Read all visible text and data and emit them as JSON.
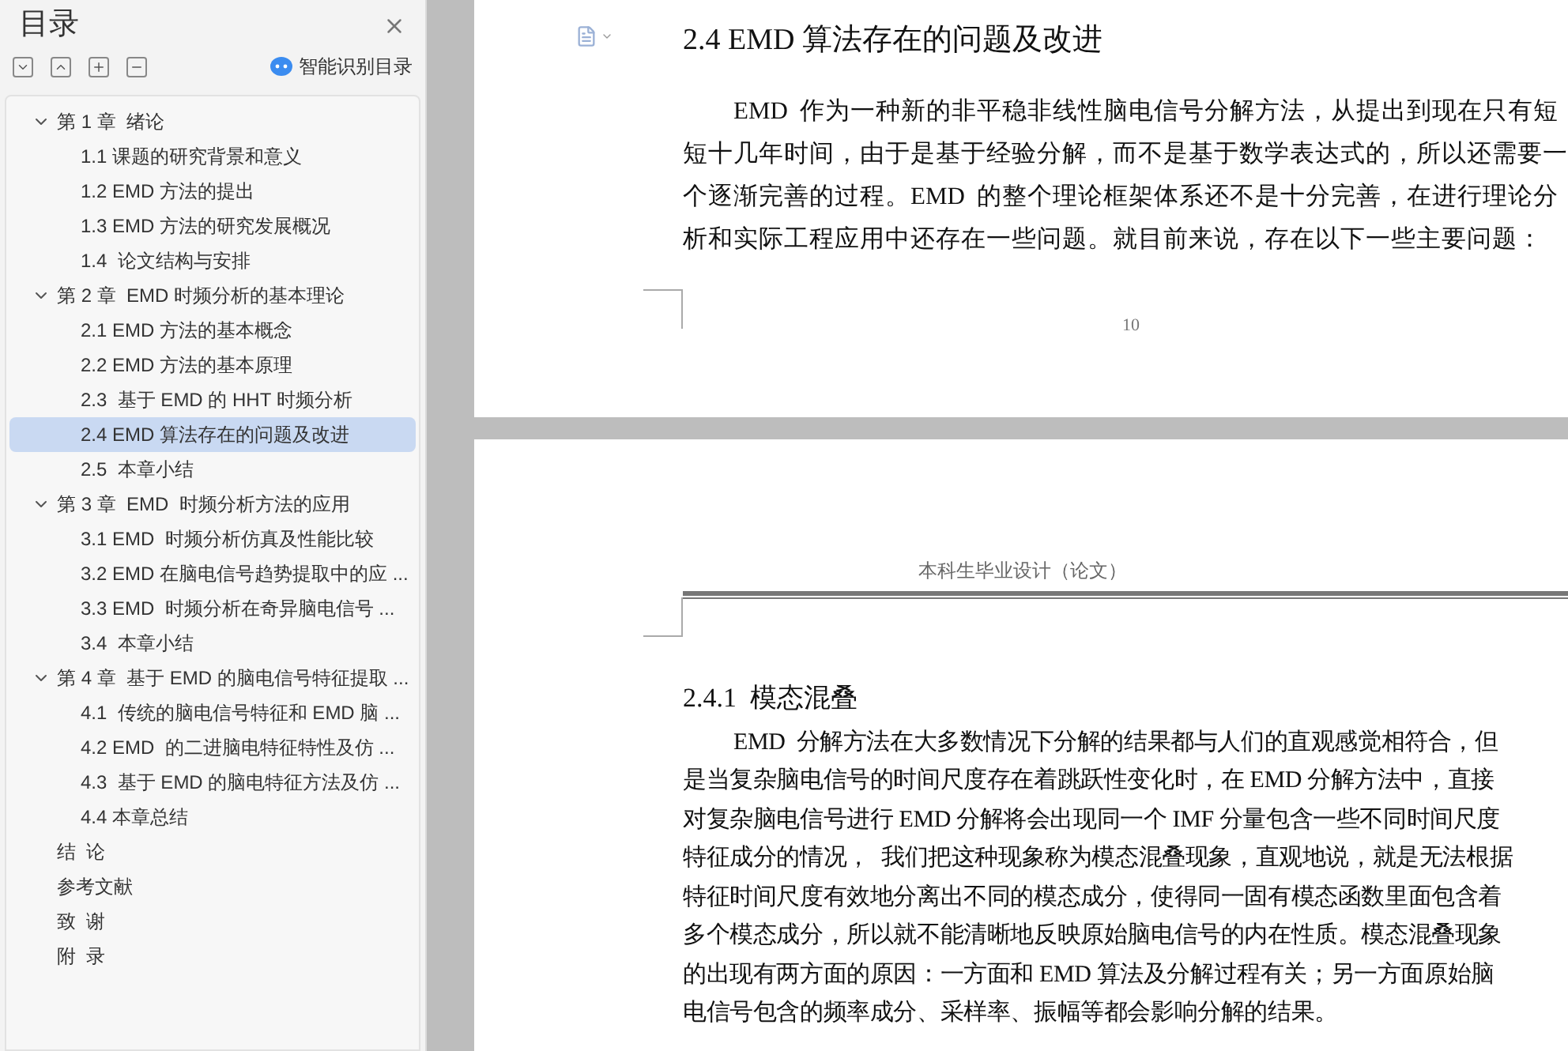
{
  "sidebar": {
    "title": "目录",
    "smart_button": "智能识别目录",
    "toc": [
      {
        "label": "第 1 章  绪论",
        "expanded": true,
        "selected": false,
        "children": [
          {
            "label": "1.1 课题的研究背景和意义",
            "selected": false
          },
          {
            "label": "1.2 EMD 方法的提出",
            "selected": false
          },
          {
            "label": "1.3 EMD 方法的研究发展概况",
            "selected": false
          },
          {
            "label": "1.4  论文结构与安排",
            "selected": false
          }
        ]
      },
      {
        "label": "第 2 章  EMD 时频分析的基本理论",
        "expanded": true,
        "selected": false,
        "children": [
          {
            "label": "2.1 EMD 方法的基本概念",
            "selected": false
          },
          {
            "label": "2.2 EMD 方法的基本原理",
            "selected": false
          },
          {
            "label": "2.3  基于 EMD 的 HHT 时频分析",
            "selected": false
          },
          {
            "label": "2.4 EMD 算法存在的问题及改进",
            "selected": true
          },
          {
            "label": "2.5  本章小结",
            "selected": false
          }
        ]
      },
      {
        "label": "第 3 章  EMD  时频分析方法的应用",
        "expanded": true,
        "selected": false,
        "children": [
          {
            "label": "3.1 EMD  时频分析仿真及性能比较",
            "selected": false
          },
          {
            "label": "3.2 EMD 在脑电信号趋势提取中的应 ...",
            "selected": false
          },
          {
            "label": "3.3 EMD  时频分析在奇异脑电信号 ...",
            "selected": false
          },
          {
            "label": "3.4  本章小结",
            "selected": false
          }
        ]
      },
      {
        "label": "第 4 章  基于 EMD 的脑电信号特征提取 ...",
        "expanded": true,
        "selected": false,
        "children": [
          {
            "label": "4.1  传统的脑电信号特征和 EMD 脑 ...",
            "selected": false
          },
          {
            "label": "4.2 EMD  的二进脑电特征特性及仿 ...",
            "selected": false
          },
          {
            "label": "4.3  基于 EMD 的脑电特征方法及仿 ...",
            "selected": false
          },
          {
            "label": "4.4 本章总结",
            "selected": false
          }
        ]
      },
      {
        "label": "结  论",
        "selected": false
      },
      {
        "label": "参考文献",
        "selected": false
      },
      {
        "label": "致  谢",
        "selected": false
      },
      {
        "label": "附  录",
        "selected": false
      }
    ]
  },
  "page1": {
    "heading": "2.4 EMD 算法存在的问题及改进",
    "lines": [
      "EMD  作为一种新的非平稳非线性脑电信号分解方法，从提出到现在只有短",
      "短十几年时间，由于是基于经验分解，而不是基于数学表达式的，所以还需要一",
      "个逐渐完善的过程。EMD  的整个理论框架体系还不是十分完善，在进行理论分",
      "析和实际工程应用中还存在一些问题。就目前来说，存在以下一些主要问题："
    ],
    "page_number": "10"
  },
  "page2": {
    "header": "本科生毕业设计（论文）",
    "heading": "2.4.1  模态混叠",
    "lines": [
      "EMD  分解方法在大多数情况下分解的结果都与人们的直观感觉相符合，但",
      "是当复杂脑电信号的时间尺度存在着跳跃性变化时，在 EMD 分解方法中，直接",
      "对复杂脑电信号进行 EMD 分解将会出现同一个 IMF 分量包含一些不同时间尺度",
      "特征成分的情况，  我们把这种现象称为模态混叠现象，直观地说，就是无法根据",
      "特征时间尺度有效地分离出不同的模态成分，使得同一固有模态函数里面包含着",
      "多个模态成分，所以就不能清晰地反映原始脑电信号的内在性质。模态混叠现象",
      "的出现有两方面的原因：一方面和 EMD 算法及分解过程有关；另一方面原始脑",
      "电信号包含的频率成分、采样率、振幅等都会影响分解的结果。"
    ]
  }
}
